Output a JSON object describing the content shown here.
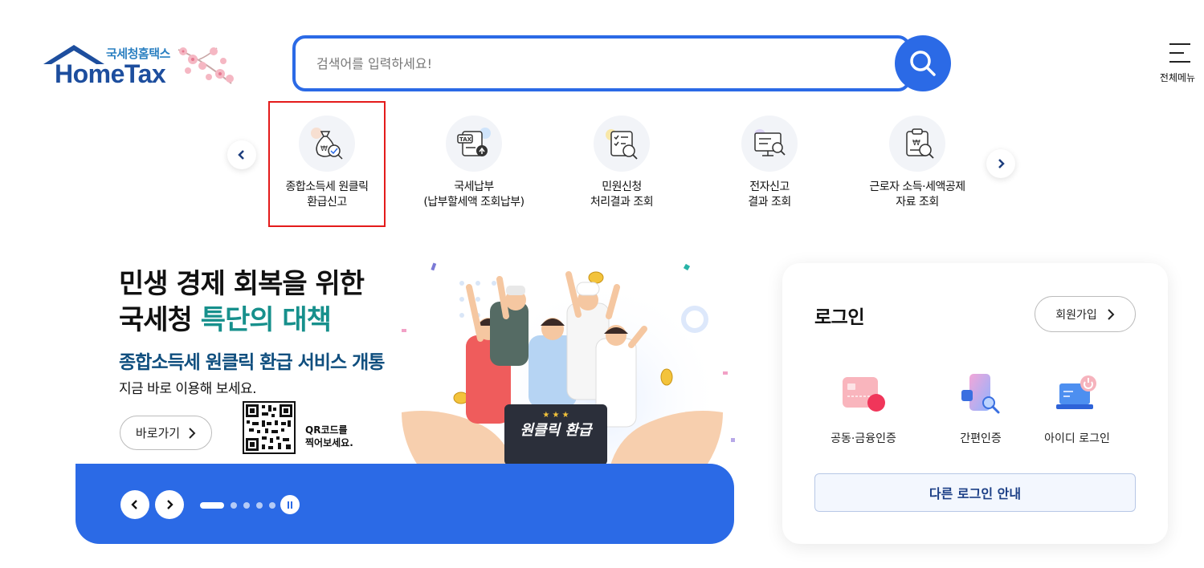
{
  "header": {
    "logo_sub": "국세청홈택스",
    "logo_main": "HomeTax",
    "search_placeholder": "검색어를 입력하세요!",
    "all_menu_label": "전체메뉴"
  },
  "quick_menu": {
    "items": [
      {
        "line1": "종합소득세 원클릭",
        "line2": "환급신고",
        "icon": "money-bag-check-icon"
      },
      {
        "line1": "국세납부",
        "line2": "(납부할세액 조회납부)",
        "icon": "tax-document-upload-icon"
      },
      {
        "line1": "민원신청",
        "line2": "처리결과 조회",
        "icon": "document-search-icon"
      },
      {
        "line1": "전자신고",
        "line2": "결과 조회",
        "icon": "monitor-search-icon"
      },
      {
        "line1": "근로자 소득·세액공제",
        "line2": "자료 조회",
        "icon": "clipboard-search-icon"
      }
    ]
  },
  "banner": {
    "headline_line1": "민생 경제 회복을 위한",
    "headline_line2_a": "국세청 ",
    "headline_line2_b": "특단의 대책",
    "subheadline": "종합소득세 원클릭 환급 서비스 개통",
    "body": "지금 바로 이용해 보세요.",
    "go_button": "바로가기",
    "qr_line1": "QR코드를",
    "qr_line2": "찍어보세요.",
    "sign_text": "원클릭 환급",
    "sign_stars": "★ ★ ★",
    "slide_count": 5,
    "active_slide": 1
  },
  "login": {
    "title": "로그인",
    "signup_button": "회원가입",
    "options": [
      {
        "label": "공동·금융인증",
        "icon": "certificate-card-icon"
      },
      {
        "label": "간편인증",
        "icon": "mobile-search-icon"
      },
      {
        "label": "아이디 로그인",
        "icon": "laptop-power-icon"
      }
    ],
    "other_login": "다른 로그인 안내"
  },
  "colors": {
    "brand_blue": "#2b6ae6",
    "teal": "#17908c",
    "navy": "#0f4e7e",
    "highlight_red": "#e41b1b"
  }
}
